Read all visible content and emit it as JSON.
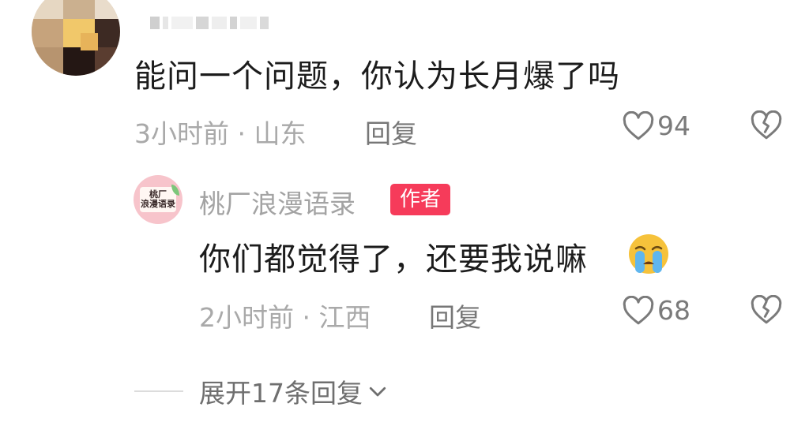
{
  "comment": {
    "author_name": "",
    "text": "能问一个问题，你认为长月爆了吗",
    "time_location": "3小时前 · 山东",
    "reply_label": "回复",
    "like_count": "94",
    "avatar_icon": "pixelated-avatar",
    "like_icon": "heart-outline-icon",
    "dislike_icon": "broken-heart-icon"
  },
  "reply": {
    "author_name": "桃厂浪漫语录",
    "badge": "作者",
    "avatar_text_line1": "桃厂",
    "avatar_text_line2": "浪漫语录",
    "text": "你们都觉得了，还要我说嘛",
    "emoji": "crying-face",
    "time_location": "2小时前 · 江西",
    "reply_label": "回复",
    "like_count": "68"
  },
  "expand": {
    "label": "展开17条回复",
    "icon": "chevron-down-icon"
  },
  "colors": {
    "badge_bg": "#f63b5a",
    "text_primary": "#1c1c1c",
    "text_secondary": "#a9a9a9",
    "avatar_reply_bg": "#f7c4cb"
  }
}
